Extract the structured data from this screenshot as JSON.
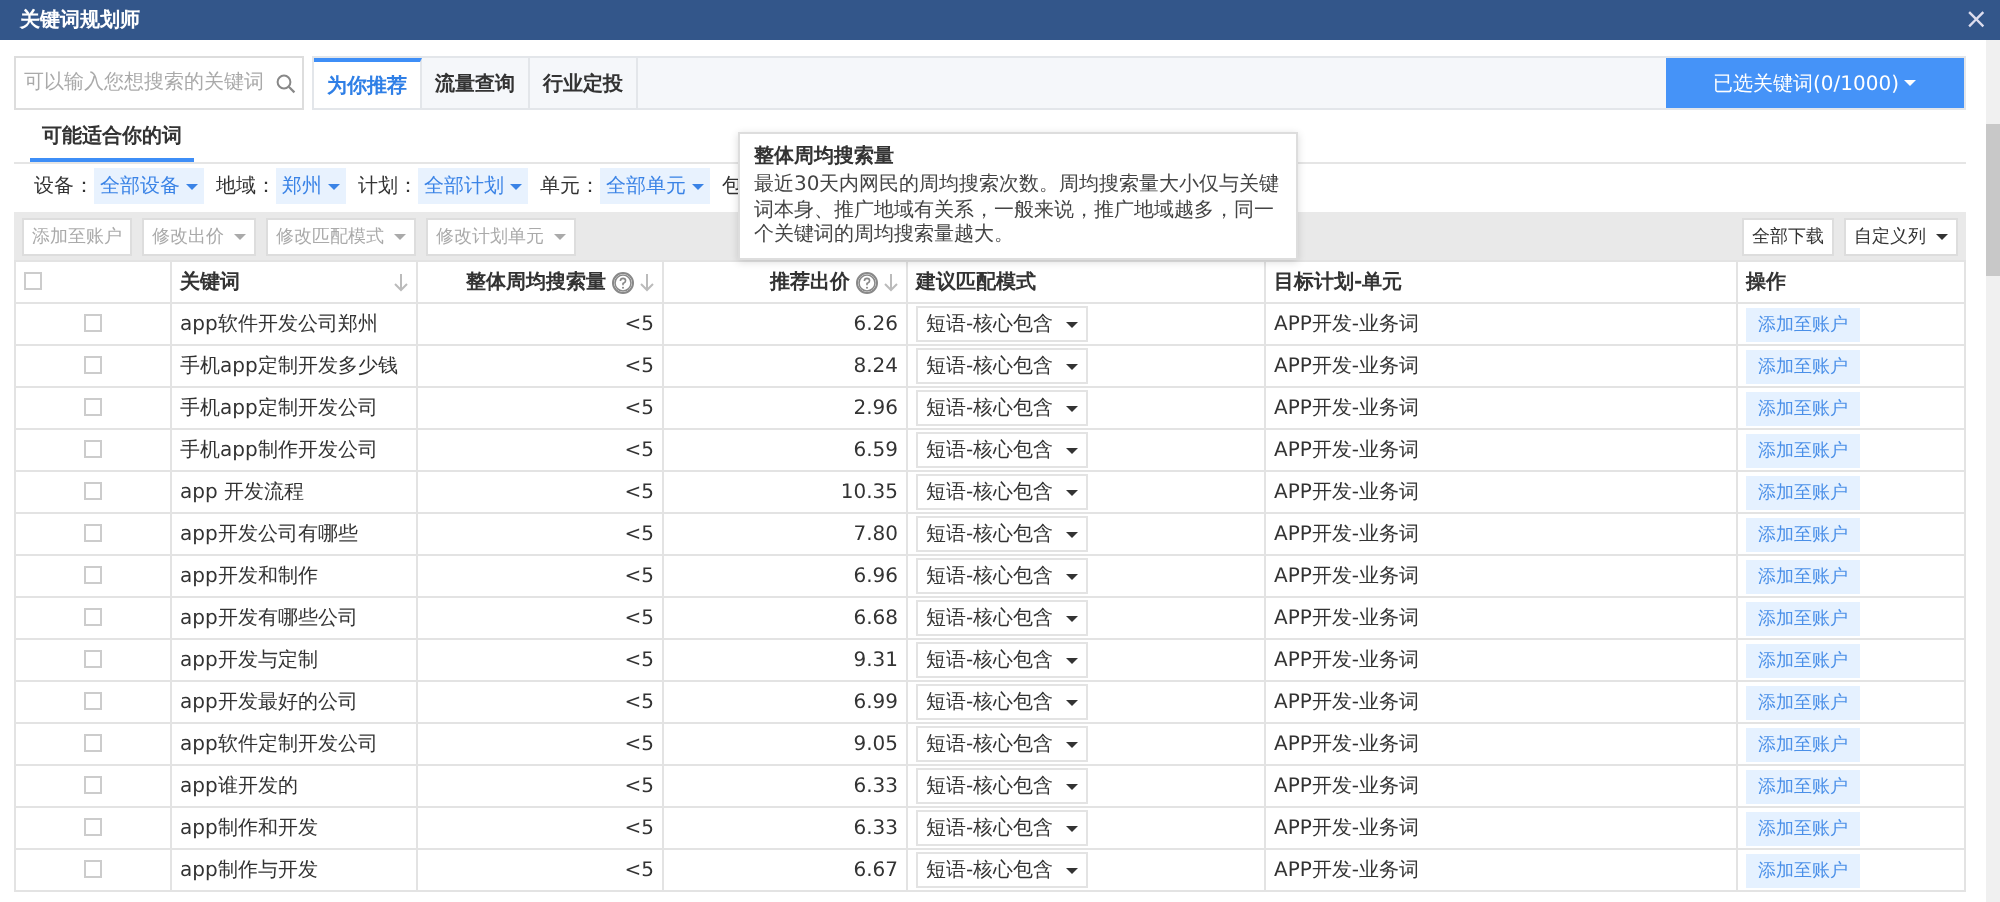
{
  "window": {
    "title": "关键词规划师",
    "close": "×"
  },
  "search": {
    "placeholder": "可以输入您想搜索的关键词"
  },
  "tabs": [
    {
      "label": "为你推荐",
      "selected": true
    },
    {
      "label": "流量查询",
      "selected": false
    },
    {
      "label": "行业定投",
      "selected": false
    }
  ],
  "selected_button": {
    "label": "已选关键词(0/1000)"
  },
  "subtabs": [
    {
      "label": "可能适合你的词",
      "selected": true
    }
  ],
  "filters": [
    {
      "label": "设备：",
      "value": "全部设备"
    },
    {
      "label": "地域：",
      "value": "郑州"
    },
    {
      "label": "计划：",
      "value": "全部计划"
    },
    {
      "label": "单元：",
      "value": "全部单元"
    },
    {
      "label": "包"
    }
  ],
  "tooltip": {
    "title": "整体周均搜索量",
    "text": "最近30天内网民的周均搜索次数。周均搜索量大小仅与关键词本身、推广地域有关系，一般来说，推广地域越多，同一个关键词的周均搜索量越大。"
  },
  "toolbar": {
    "left": [
      {
        "label": "添加至账户",
        "dropdown": false,
        "disabled": true
      },
      {
        "label": "修改出价",
        "dropdown": true,
        "disabled": true
      },
      {
        "label": "修改匹配模式",
        "dropdown": true,
        "disabled": true
      },
      {
        "label": "修改计划单元",
        "dropdown": true,
        "disabled": true
      }
    ],
    "right": [
      {
        "label": "全部下载",
        "dropdown": false,
        "disabled": false
      },
      {
        "label": "自定义列",
        "dropdown": true,
        "disabled": false
      }
    ]
  },
  "table": {
    "all_checked": false,
    "columns": [
      {
        "label": "关键词",
        "kind": "text",
        "help": false,
        "sort": true
      },
      {
        "label": "整体周均搜索量",
        "kind": "number",
        "help": true,
        "sort": true
      },
      {
        "label": "推荐出价",
        "kind": "number",
        "help": true,
        "sort": true
      },
      {
        "label": "建议匹配模式",
        "kind": "text",
        "help": false,
        "sort": false
      },
      {
        "label": "目标计划-单元",
        "kind": "text",
        "help": false,
        "sort": false
      },
      {
        "label": "操作",
        "kind": "text",
        "help": false,
        "sort": false
      }
    ],
    "rows": [
      {
        "checked": false,
        "keyword": "app软件开发公司郑州",
        "volume": "<5",
        "bid": "6.26",
        "match": "短语-核心包含",
        "target": "APP开发-业务词",
        "action": "添加至账户"
      },
      {
        "checked": false,
        "keyword": "手机app定制开发多少钱",
        "volume": "<5",
        "bid": "8.24",
        "match": "短语-核心包含",
        "target": "APP开发-业务词",
        "action": "添加至账户"
      },
      {
        "checked": false,
        "keyword": "手机app定制开发公司",
        "volume": "<5",
        "bid": "2.96",
        "match": "短语-核心包含",
        "target": "APP开发-业务词",
        "action": "添加至账户"
      },
      {
        "checked": false,
        "keyword": "手机app制作开发公司",
        "volume": "<5",
        "bid": "6.59",
        "match": "短语-核心包含",
        "target": "APP开发-业务词",
        "action": "添加至账户"
      },
      {
        "checked": false,
        "keyword": "app 开发流程",
        "volume": "<5",
        "bid": "10.35",
        "match": "短语-核心包含",
        "target": "APP开发-业务词",
        "action": "添加至账户"
      },
      {
        "checked": false,
        "keyword": "app开发公司有哪些",
        "volume": "<5",
        "bid": "7.80",
        "match": "短语-核心包含",
        "target": "APP开发-业务词",
        "action": "添加至账户"
      },
      {
        "checked": false,
        "keyword": "app开发和制作",
        "volume": "<5",
        "bid": "6.96",
        "match": "短语-核心包含",
        "target": "APP开发-业务词",
        "action": "添加至账户"
      },
      {
        "checked": false,
        "keyword": "app开发有哪些公司",
        "volume": "<5",
        "bid": "6.68",
        "match": "短语-核心包含",
        "target": "APP开发-业务词",
        "action": "添加至账户"
      },
      {
        "checked": false,
        "keyword": "app开发与定制",
        "volume": "<5",
        "bid": "9.31",
        "match": "短语-核心包含",
        "target": "APP开发-业务词",
        "action": "添加至账户"
      },
      {
        "checked": false,
        "keyword": "app开发最好的公司",
        "volume": "<5",
        "bid": "6.99",
        "match": "短语-核心包含",
        "target": "APP开发-业务词",
        "action": "添加至账户"
      },
      {
        "checked": false,
        "keyword": "app软件定制开发公司",
        "volume": "<5",
        "bid": "9.05",
        "match": "短语-核心包含",
        "target": "APP开发-业务词",
        "action": "添加至账户"
      },
      {
        "checked": false,
        "keyword": "app谁开发的",
        "volume": "<5",
        "bid": "6.33",
        "match": "短语-核心包含",
        "target": "APP开发-业务词",
        "action": "添加至账户"
      },
      {
        "checked": false,
        "keyword": "app制作和开发",
        "volume": "<5",
        "bid": "6.33",
        "match": "短语-核心包含",
        "target": "APP开发-业务词",
        "action": "添加至账户"
      },
      {
        "checked": false,
        "keyword": "app制作与开发",
        "volume": "<5",
        "bid": "6.67",
        "match": "短语-核心包含",
        "target": "APP开发-业务词",
        "action": "添加至账户"
      }
    ]
  }
}
